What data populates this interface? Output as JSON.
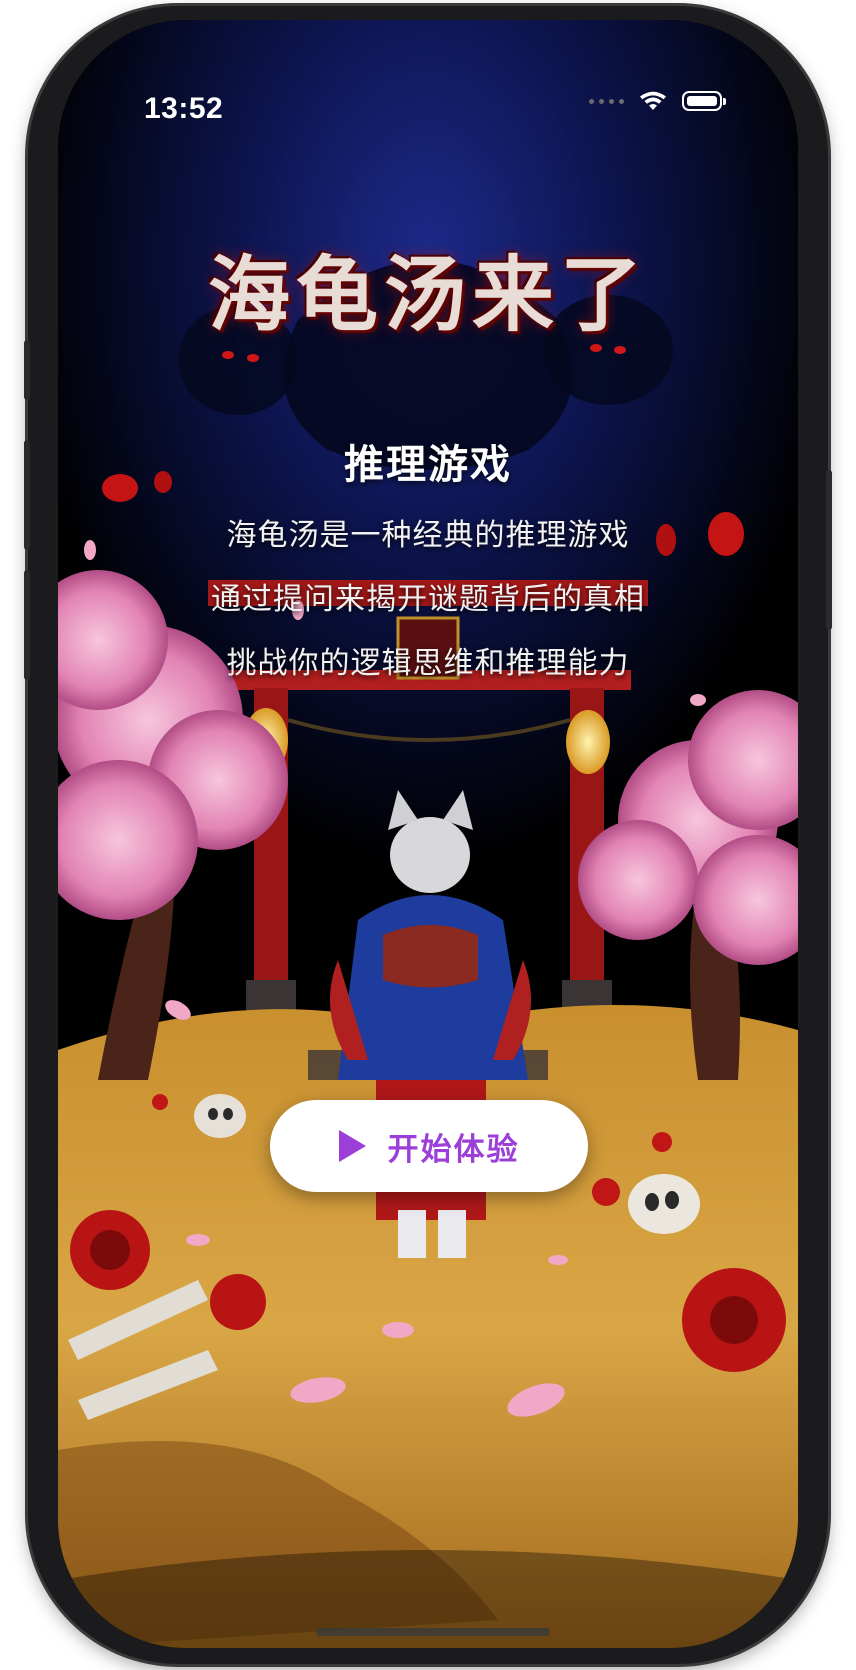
{
  "status_bar": {
    "time": "13:52",
    "wifi_icon": "wifi-icon",
    "battery_icon": "battery-icon"
  },
  "hero": {
    "title": "海龟汤来了",
    "subtitle": "推理游戏",
    "description_lines": [
      "海龟汤是一种经典的推理游戏",
      "通过提问来揭开谜题背后的真相",
      "挑战你的逻辑思维和推理能力"
    ]
  },
  "start_button": {
    "label": "开始体验",
    "icon": "play-icon",
    "accent_color": "#9b3fd8"
  },
  "background": {
    "illustration": "shrine gate with cherry blossoms and kimono-clad fox girl"
  }
}
